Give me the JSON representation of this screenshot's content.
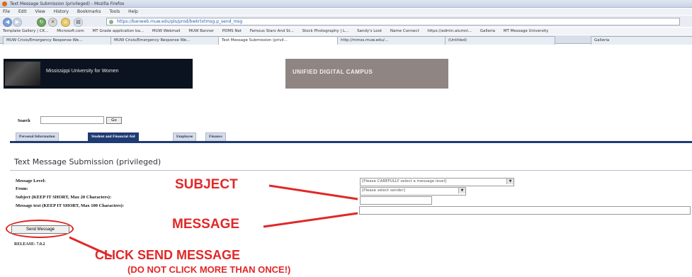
{
  "browser": {
    "window_title": "Text Message Submission (privileged) - Mozilla Firefox",
    "menu": [
      "File",
      "Edit",
      "View",
      "History",
      "Bookmarks",
      "Tools",
      "Help"
    ],
    "url": "https://banweb.muw.edu/pls/prod/bwkrtxtmsg.p_send_msg",
    "bookmarks": [
      "Template Gallery | CK...",
      "Microsoft.com",
      "MT Grade application ba...",
      "MUW Webmail",
      "MUW Banner",
      "PDMS Net",
      "Famous Stars And St...",
      "Stock Photography | L...",
      "Sandy's Loot",
      "Name Connect",
      "https://admin.alumni...",
      "Galleria",
      "MT Message University"
    ],
    "tabs": [
      "MUW Crisis/Emergency Response We...",
      "MUW Crisis/Emergency Response We...",
      "Text Message Submission (privil...",
      "http://mmss.muw.edu/...",
      "(Untitled)",
      "Galleria"
    ]
  },
  "banner": {
    "university": "Mississippi University for Women",
    "campus": "UNIFIED DIGITAL CAMPUS"
  },
  "search": {
    "label": "Search",
    "go": "Go"
  },
  "nav_tabs": [
    {
      "label": "Personal Information"
    },
    {
      "label": "Student and Financial Aid"
    },
    {
      "label": "Employee"
    },
    {
      "label": "Finance"
    }
  ],
  "page": {
    "title": "Text Message Submission (privileged)",
    "release": "RELEASE: 7.0.2"
  },
  "form": {
    "message_level_label": "Message Level:",
    "from_label": "From:",
    "subject_label": "Subject (KEEP IT SHORT, Max 20 Characters):",
    "message_label": "Message text (KEEP IT SHORT, Max 100 Characters):",
    "message_level_value": "[Please CAREFULLY select a message level]",
    "from_value": "[Please select sender]",
    "subject_value": "",
    "message_value": "",
    "send_label": "Send Message"
  },
  "annotations": {
    "subject": "SUBJECT",
    "message": "MESSAGE",
    "click_send": "CLICK SEND MESSAGE",
    "do_not_click": "(DO NOT CLICK  MORE THAN ONCE!)"
  },
  "colors": {
    "annotation_red": "#e02828",
    "nav_blue": "#1f3b73",
    "banner_dark": "#0b1320",
    "banner_taupe": "#8f8683"
  }
}
